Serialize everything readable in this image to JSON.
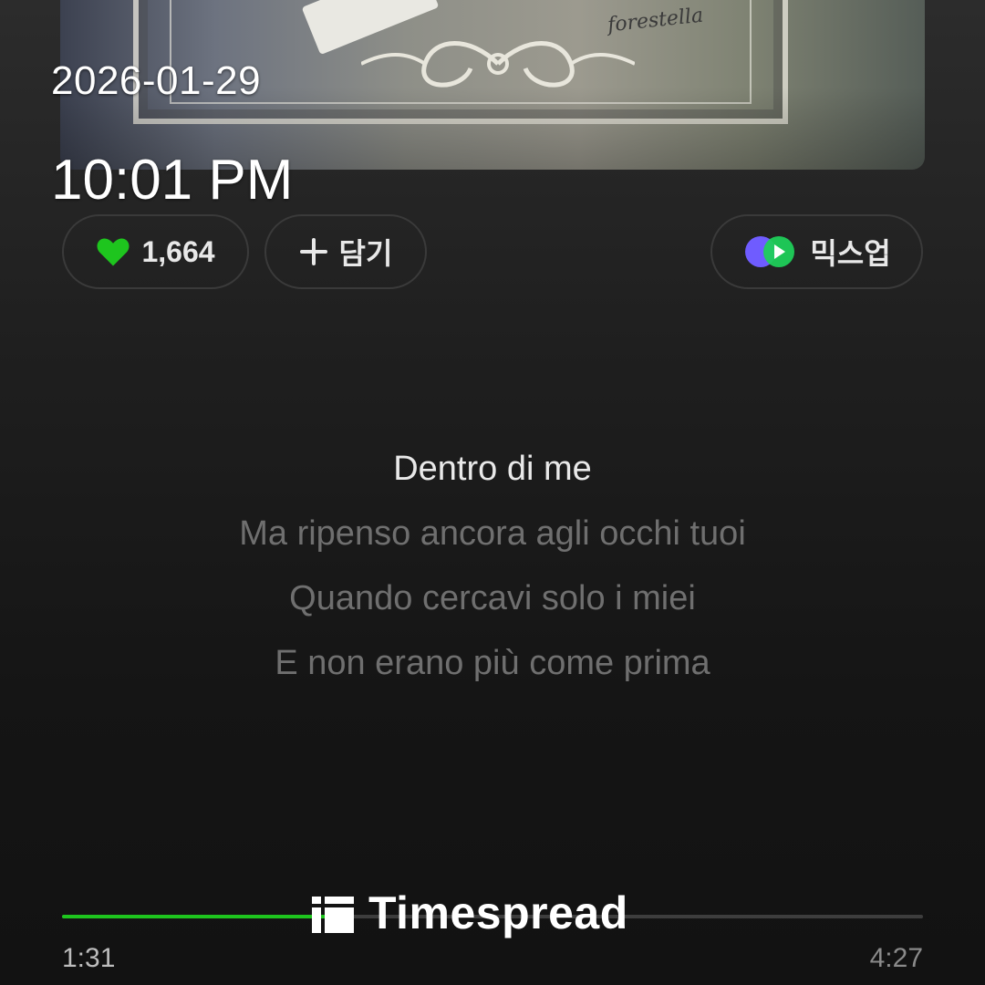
{
  "overlay": {
    "date": "2026-01-29",
    "time": "10:01 PM"
  },
  "album": {
    "signature": "forestella"
  },
  "actions": {
    "like": {
      "icon": "heart-icon",
      "count": "1,664",
      "color": "#1ec51e"
    },
    "add": {
      "icon": "plus-icon",
      "label": "담기"
    },
    "mixup": {
      "icon": "mixup-icon",
      "label": "믹스업"
    }
  },
  "lyrics": {
    "current": "Dentro di me",
    "upcoming": [
      "Ma ripenso ancora agli occhi tuoi",
      "Quando cercavi solo i miei",
      "E non erano più come prima"
    ]
  },
  "watermark": {
    "text": "Timespread"
  },
  "player": {
    "elapsed": "1:31",
    "total": "4:27",
    "progress": 0.31,
    "accent": "#1ec51e"
  }
}
